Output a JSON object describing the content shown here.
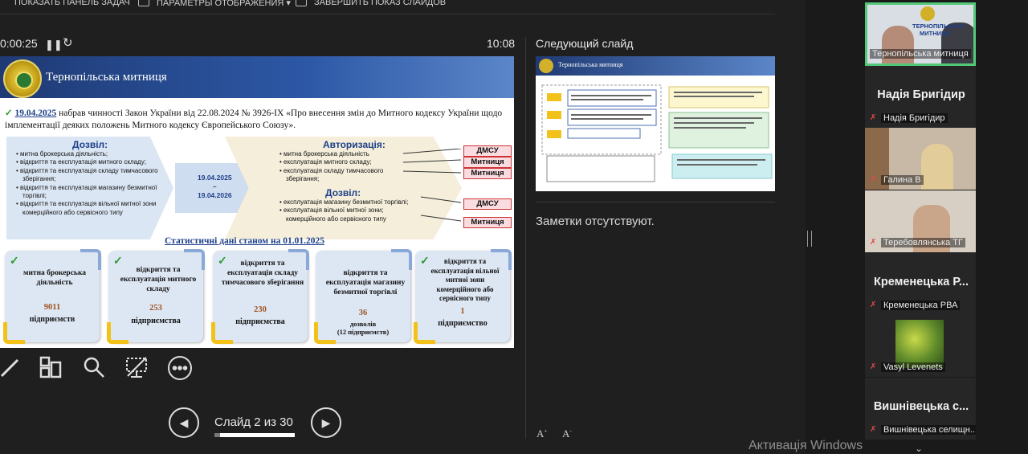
{
  "toolbar": {
    "show_taskbar": "ПОКАЗАТЬ ПАНЕЛЬ ЗАДАЧ",
    "display_settings": "ПАРАМЕТРЫ ОТОБРАЖЕНИЯ ▾",
    "end_show": "ЗАВЕРШИТЬ ПОКАЗ СЛАЙДОВ"
  },
  "presenter": {
    "timer": "0:00:25",
    "clock": "10:08",
    "next_slide_label": "Следующий слайд",
    "notes": "Заметки отсутствуют.",
    "slide_counter": "Слайд 2 из 30",
    "progress": 0.067
  },
  "slide": {
    "title": "Тернопільська митниця",
    "law_date": "19.04.2025",
    "law_text": " набрав чинності Закон України від 22.08.2024 № 3926-IX «Про внесення змін до Митного кодексу України щодо імплементації деяких положень Митного кодексу Європейського Союзу».",
    "allow": {
      "title": "Дозвіл:",
      "items": [
        "митна брокерська діяльність;",
        "відкриття та експлуатація митного складу;",
        "відкриття та експлуатація складу тимчасового зберігання;",
        "відкриття та експлуатація магазину безмитної торгівлі;",
        "відкриття та експлуатація вільної митної зони комерційного або сервісного типу"
      ]
    },
    "period": {
      "from": "19.04.2025",
      "dash": "–",
      "to": "19.04.2026"
    },
    "authorization": {
      "title": "Авторизація:",
      "items": [
        "митна брокерська діяльність",
        "експлуатація митного складу;",
        "експлуатація складу тимчасового зберігання;"
      ]
    },
    "permit": {
      "title": "Дозвіл:",
      "items": [
        "експлуатація магазину безмитної торгівлі;",
        "експлуатація вільної митної зони; комерційного або сервісного типу"
      ]
    },
    "tags": [
      "ДМСУ",
      "Митниця",
      "Митниця",
      "ДМСУ",
      "Митниця"
    ],
    "stats_title": "Статистичні дані станом на 01.01.2025",
    "cards": [
      {
        "text": "митна брокерська діяльність",
        "number": "9011",
        "unit": "підприємств",
        "extra": ""
      },
      {
        "text": "відкриття та експлуатація митного складу",
        "number": "253",
        "unit": "підприємства",
        "extra": ""
      },
      {
        "text": "відкриття та експлуатація складу тимчасового зберігання",
        "number": "230",
        "unit": "підприємства",
        "extra": ""
      },
      {
        "text": "відкриття та експлуатація магазину безмитної торгівлі",
        "number": "36",
        "unit": "дозволів",
        "extra": "(12 підприємств)"
      },
      {
        "text": "відкриття та експлуатація вільної митної зони комерційного або сервісного типу",
        "number": "1",
        "unit": "підприємство",
        "extra": ""
      }
    ]
  },
  "next_slide": {
    "title": "Тернопільська митниця"
  },
  "tools": [
    "pen-icon",
    "slides-grid-icon",
    "zoom-icon",
    "subtitles-icon",
    "more-icon"
  ],
  "participants": [
    {
      "kind": "video",
      "label": "Тернопільська митниця",
      "emblem_text": "ТЕРНОПІЛЬСЬКА МИТНИЦЯ",
      "active": true
    },
    {
      "kind": "name",
      "big": "Надія Бригідир",
      "label": "Надія Бригідир"
    },
    {
      "kind": "video",
      "label": "Галина В"
    },
    {
      "kind": "video",
      "label": "Теребовлянська ТГ"
    },
    {
      "kind": "name",
      "big": "Кременецька Р...",
      "label": "Кременецька РВА"
    },
    {
      "kind": "avatar",
      "label": "Vasyl Levenets"
    },
    {
      "kind": "name",
      "big": "Вишнівецька с...",
      "label": "Вишнівецька селищн..."
    }
  ],
  "windows_watermark": "Активація Windows",
  "colors": {
    "accent_green": "#54c97a",
    "slide_blue": "#1f3a74",
    "mic_muted": "#e04848"
  }
}
